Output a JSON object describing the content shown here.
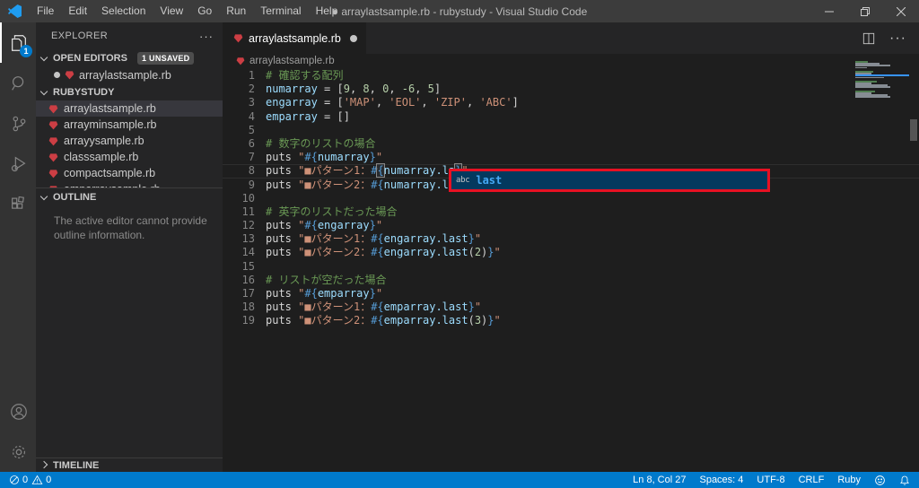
{
  "titlebar": {
    "menus": [
      "File",
      "Edit",
      "Selection",
      "View",
      "Go",
      "Run",
      "Terminal",
      "Help"
    ],
    "title": "● arraylastsample.rb - rubystudy - Visual Studio Code",
    "window_control_icons": [
      "minimize-icon",
      "restore-icon",
      "close-icon"
    ]
  },
  "activity_bar": {
    "explorer_badge": "1",
    "icons": [
      "files-icon",
      "search-icon",
      "source-control-icon",
      "run-debug-icon",
      "extensions-icon",
      "account-icon",
      "gear-icon"
    ]
  },
  "sidebar": {
    "header": "EXPLORER",
    "actions_icon": "more-actions-icon",
    "open_editors": {
      "label": "OPEN EDITORS",
      "badge": "1 UNSAVED",
      "items": [
        {
          "name": "arraylastsample.rb",
          "modified": true
        }
      ]
    },
    "folder": {
      "label": "RUBYSTUDY",
      "selected": "arraylastsample.rb",
      "files": [
        "arraylastsample.rb",
        "arrayminsample.rb",
        "arrayysample.rb",
        "classsample.rb",
        "compactsample.rb",
        "emparraysample.rb"
      ]
    },
    "outline": {
      "label": "OUTLINE",
      "message": "The active editor cannot provide outline information."
    },
    "timeline": {
      "label": "TIMELINE"
    }
  },
  "editor": {
    "tab": {
      "name": "arraylastsample.rb",
      "modified": true
    },
    "tab_action_icons": [
      "split-editor-icon",
      "more-actions-icon"
    ],
    "breadcrumb": "arraylastsample.rb",
    "cursor_line": 8,
    "suggest": {
      "kind": "abc",
      "label": "last"
    },
    "annotation_color": "#e81123",
    "lines": [
      {
        "n": 1,
        "tokens": [
          [
            "cm",
            "# 確認する配列"
          ]
        ]
      },
      {
        "n": 2,
        "tokens": [
          [
            "var",
            "numarray"
          ],
          [
            "pl",
            " = ["
          ],
          [
            "num",
            "9"
          ],
          [
            "pl",
            ", "
          ],
          [
            "num",
            "8"
          ],
          [
            "pl",
            ", "
          ],
          [
            "num",
            "0"
          ],
          [
            "pl",
            ", "
          ],
          [
            "num",
            "-6"
          ],
          [
            "pl",
            ", "
          ],
          [
            "num",
            "5"
          ],
          [
            "pl",
            "]"
          ]
        ]
      },
      {
        "n": 3,
        "tokens": [
          [
            "var",
            "engarray"
          ],
          [
            "pl",
            " = ["
          ],
          [
            "st",
            "'MAP'"
          ],
          [
            "pl",
            ", "
          ],
          [
            "st",
            "'EOL'"
          ],
          [
            "pl",
            ", "
          ],
          [
            "st",
            "'ZIP'"
          ],
          [
            "pl",
            ", "
          ],
          [
            "st",
            "'ABC'"
          ],
          [
            "pl",
            "]"
          ]
        ]
      },
      {
        "n": 4,
        "tokens": [
          [
            "var",
            "emparray"
          ],
          [
            "pl",
            " = []"
          ]
        ]
      },
      {
        "n": 5,
        "tokens": []
      },
      {
        "n": 6,
        "tokens": [
          [
            "cm",
            "# 数字のリストの場合"
          ]
        ]
      },
      {
        "n": 7,
        "tokens": [
          [
            "pl",
            "puts "
          ],
          [
            "st",
            "\""
          ],
          [
            "kw",
            "#{"
          ],
          [
            "var",
            "numarray"
          ],
          [
            "kw",
            "}"
          ],
          [
            "st",
            "\""
          ]
        ]
      },
      {
        "n": 8,
        "tokens": [
          [
            "pl",
            "puts "
          ],
          [
            "st",
            "\"■パターン1："
          ],
          [
            "kw",
            "#"
          ],
          [
            "kwb",
            "{"
          ],
          [
            "var",
            "numarray.la"
          ],
          [
            "caret",
            ""
          ],
          [
            "kwb",
            "}"
          ],
          [
            "st",
            "\""
          ]
        ]
      },
      {
        "n": 9,
        "tokens": [
          [
            "pl",
            "puts "
          ],
          [
            "st",
            "\"■パターン2："
          ],
          [
            "kw",
            "#{"
          ],
          [
            "var",
            "numarray.la"
          ]
        ]
      },
      {
        "n": 10,
        "tokens": []
      },
      {
        "n": 11,
        "tokens": [
          [
            "cm",
            "# 英字のリストだった場合"
          ]
        ]
      },
      {
        "n": 12,
        "tokens": [
          [
            "pl",
            "puts "
          ],
          [
            "st",
            "\""
          ],
          [
            "kw",
            "#{"
          ],
          [
            "var",
            "engarray"
          ],
          [
            "kw",
            "}"
          ],
          [
            "st",
            "\""
          ]
        ]
      },
      {
        "n": 13,
        "tokens": [
          [
            "pl",
            "puts "
          ],
          [
            "st",
            "\"■パターン1："
          ],
          [
            "kw",
            "#{"
          ],
          [
            "var",
            "engarray.last"
          ],
          [
            "kw",
            "}"
          ],
          [
            "st",
            "\""
          ]
        ]
      },
      {
        "n": 14,
        "tokens": [
          [
            "pl",
            "puts "
          ],
          [
            "st",
            "\"■パターン2："
          ],
          [
            "kw",
            "#{"
          ],
          [
            "var",
            "engarray.last"
          ],
          [
            "pl",
            "("
          ],
          [
            "num",
            "2"
          ],
          [
            "pl",
            ")"
          ],
          [
            "kw",
            "}"
          ],
          [
            "st",
            "\""
          ]
        ]
      },
      {
        "n": 15,
        "tokens": []
      },
      {
        "n": 16,
        "tokens": [
          [
            "cm",
            "# リストが空だった場合"
          ]
        ]
      },
      {
        "n": 17,
        "tokens": [
          [
            "pl",
            "puts "
          ],
          [
            "st",
            "\""
          ],
          [
            "kw",
            "#{"
          ],
          [
            "var",
            "emparray"
          ],
          [
            "kw",
            "}"
          ],
          [
            "st",
            "\""
          ]
        ]
      },
      {
        "n": 18,
        "tokens": [
          [
            "pl",
            "puts "
          ],
          [
            "st",
            "\"■パターン1："
          ],
          [
            "kw",
            "#{"
          ],
          [
            "var",
            "emparray.last"
          ],
          [
            "kw",
            "}"
          ],
          [
            "st",
            "\""
          ]
        ]
      },
      {
        "n": 19,
        "tokens": [
          [
            "pl",
            "puts "
          ],
          [
            "st",
            "\"■パターン2："
          ],
          [
            "kw",
            "#{"
          ],
          [
            "var",
            "emparray.last"
          ],
          [
            "pl",
            "("
          ],
          [
            "num",
            "3"
          ],
          [
            "pl",
            ")"
          ],
          [
            "kw",
            "}"
          ],
          [
            "st",
            "\""
          ]
        ]
      }
    ]
  },
  "status_bar": {
    "errors": "0",
    "warnings": "0",
    "cursor": "Ln 8, Col 27",
    "indent": "Spaces: 4",
    "encoding": "UTF-8",
    "eol": "CRLF",
    "language": "Ruby",
    "right_icons": [
      "feedback-icon",
      "bell-icon"
    ]
  },
  "colors": {
    "accent": "#007acc",
    "ruby_icon": "#cc3e44",
    "annotation_red": "#e81123",
    "suggest_selected_bg": "#04395e"
  }
}
